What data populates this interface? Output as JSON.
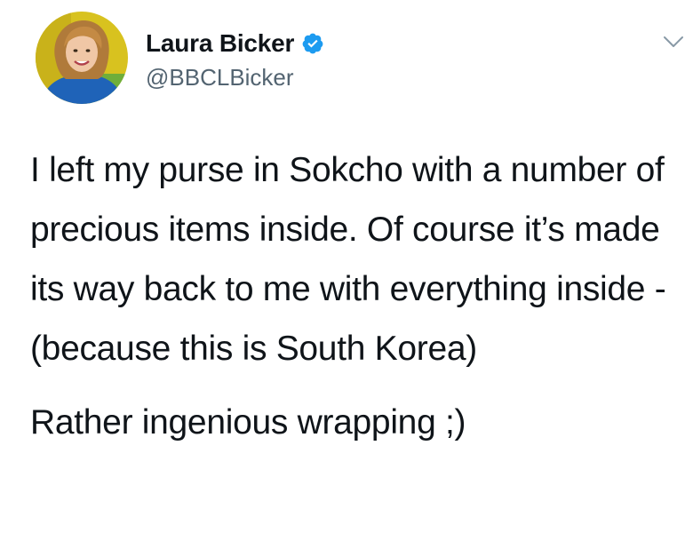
{
  "author": {
    "display_name": "Laura Bicker",
    "handle": "@BBCLBicker",
    "verified": true,
    "avatar_icon": "profile-photo"
  },
  "tweet": {
    "paragraphs": [
      "I left my purse in Sokcho with a number of precious items inside. Of course it’s made its way back to me with everything inside - (because this is South Korea)",
      "Rather ingenious wrapping ;)"
    ]
  },
  "icons": {
    "verified": "verified-badge-icon",
    "menu": "chevron-down-icon"
  },
  "colors": {
    "verified_badge": "#1d9bf0",
    "handle": "#536471",
    "text": "#0f1419",
    "caret": "#8899a6"
  }
}
